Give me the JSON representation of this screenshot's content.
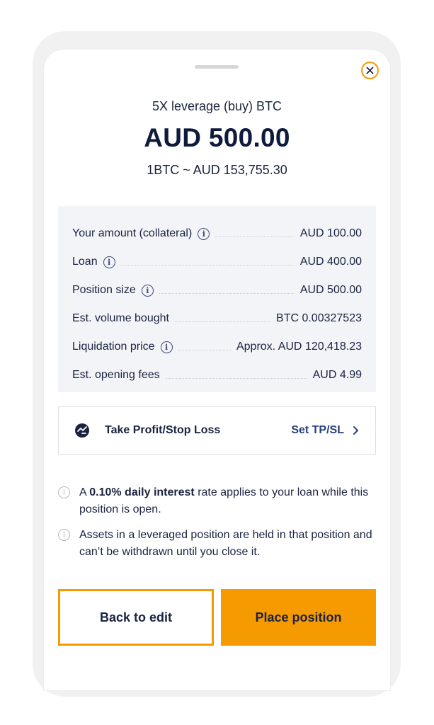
{
  "header": {
    "subtitle": "5X leverage (buy) BTC",
    "amount": "AUD 500.00",
    "rate": "1BTC ~  AUD 153,755.30"
  },
  "summary": {
    "rows": [
      {
        "label": "Your amount (collateral)",
        "value": "AUD 100.00",
        "info": true
      },
      {
        "label": "Loan",
        "value": "AUD 400.00",
        "info": true
      },
      {
        "label": "Position size",
        "value": "AUD 500.00",
        "info": true
      },
      {
        "label": "Est. volume bought",
        "value": "BTC 0.00327523",
        "info": false
      },
      {
        "label": "Liquidation price",
        "value": "Approx. AUD 120,418.23",
        "info": true
      },
      {
        "label": "Est. opening fees",
        "value": "AUD 4.99",
        "info": false
      }
    ]
  },
  "tpsl": {
    "label": "Take Profit/Stop Loss",
    "action": "Set TP/SL",
    "icon": "tpsl-icon"
  },
  "notes": {
    "note1": {
      "prefix": "A ",
      "bold": "0.10% daily interest",
      "suffix": " rate applies to your loan while this position is open."
    },
    "note2": {
      "text": "Assets in a leveraged position are held in that position and can’t be withdrawn until you close it."
    }
  },
  "buttons": {
    "back": "Back to edit",
    "place": "Place position"
  },
  "colors": {
    "accent": "#f59a00",
    "text": "#1a2340",
    "link": "#27407e",
    "panel": "#f3f4f7"
  }
}
